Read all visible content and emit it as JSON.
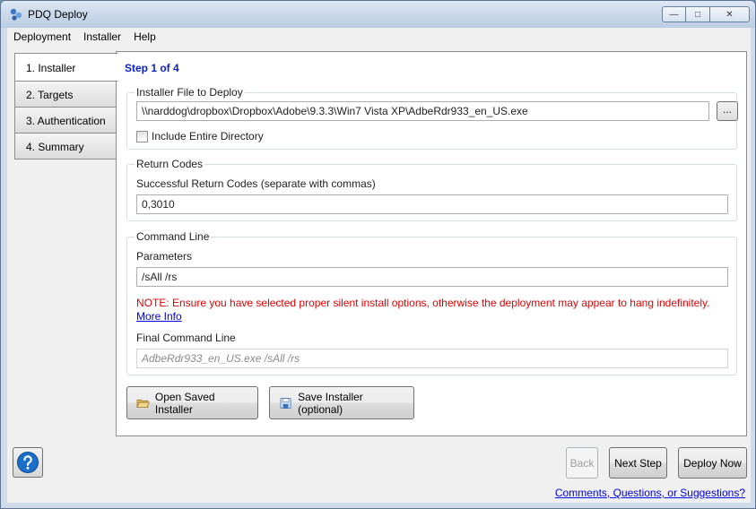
{
  "window": {
    "title": "PDQ Deploy",
    "minimize_glyph": "—",
    "maximize_glyph": "□",
    "close_glyph": "✕"
  },
  "menu": [
    "Deployment",
    "Installer",
    "Help"
  ],
  "tabs": [
    "1. Installer",
    "2. Targets",
    "3. Authentication",
    "4. Summary"
  ],
  "active_tab": 0,
  "step_title": "Step 1 of 4",
  "installer_group": {
    "label": "Installer File to Deploy",
    "file_path": "\\\\narddog\\dropbox\\Dropbox\\Adobe\\9.3.3\\Win7 Vista XP\\AdbeRdr933_en_US.exe",
    "browse_label": "...",
    "include_directory_label": "Include Entire Directory",
    "include_directory_checked": false
  },
  "return_codes_group": {
    "label": "Return Codes",
    "field_label": "Successful Return Codes (separate with commas)",
    "value": "0,3010"
  },
  "command_line_group": {
    "label": "Command Line",
    "parameters_label": "Parameters",
    "parameters_value": "/sAll  /rs",
    "note": "NOTE: Ensure you have selected proper silent install options, otherwise the deployment may appear to hang indefinitely.",
    "more_info": "More Info",
    "final_label": "Final Command Line",
    "final_value": "AdbeRdr933_en_US.exe /sAll  /rs"
  },
  "buttons": {
    "open_saved": "Open Saved Installer",
    "save_installer": "Save Installer (optional)",
    "back": "Back",
    "next": "Next Step",
    "deploy": "Deploy Now"
  },
  "footer_link": "Comments, Questions, or Suggestions?",
  "colors": {
    "step_title": "#0a1fc4",
    "note": "#e00000",
    "link": "#0000dd",
    "help_icon": "#1a6fc9"
  }
}
